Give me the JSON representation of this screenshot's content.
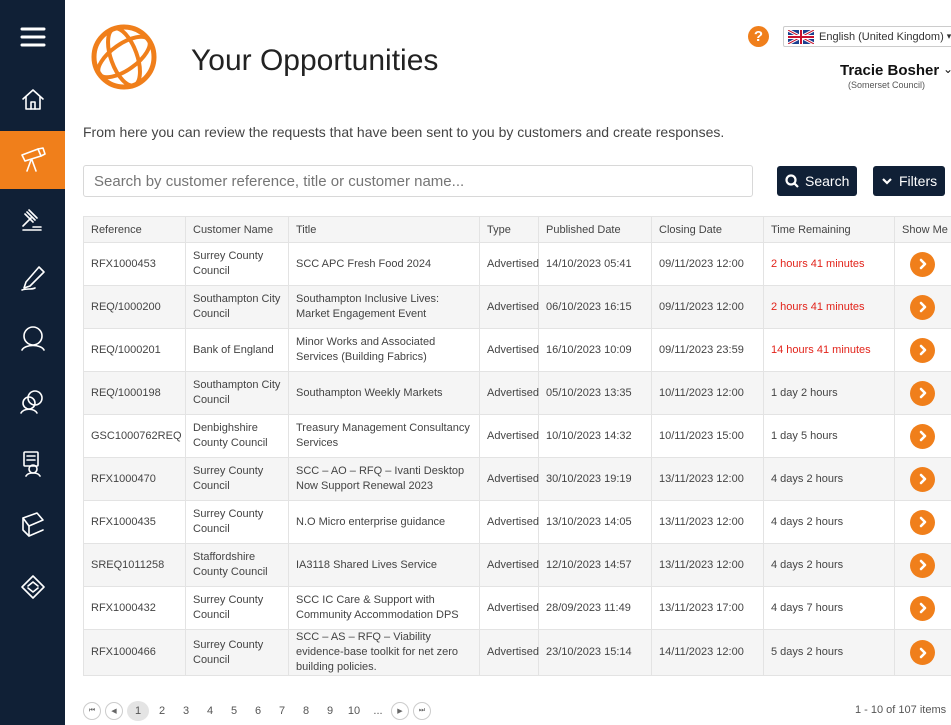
{
  "sidebar": {
    "items": [
      {
        "icon": "menu-icon",
        "active": false
      },
      {
        "icon": "home-icon",
        "active": false
      },
      {
        "icon": "telescope-icon",
        "active": true
      },
      {
        "icon": "gavel-icon",
        "active": false
      },
      {
        "icon": "pen-icon",
        "active": false
      },
      {
        "icon": "person-icon",
        "active": false
      },
      {
        "icon": "people-icon",
        "active": false
      },
      {
        "icon": "contract-user-icon",
        "active": false
      },
      {
        "icon": "book-icon",
        "active": false
      },
      {
        "icon": "handshake-icon",
        "active": false
      }
    ]
  },
  "header": {
    "title": "Your Opportunities",
    "help_label": "?",
    "language": "English (United Kingdom)",
    "user_name": "Tracie Bosher",
    "user_org": "(Somerset Council)"
  },
  "intro": "From here you can review the requests that have been sent to you by customers and create responses.",
  "search": {
    "placeholder": "Search by customer reference, title or customer name...",
    "search_label": "Search",
    "filters_label": "Filters"
  },
  "table": {
    "columns": [
      "Reference",
      "Customer Name",
      "Title",
      "Type",
      "Published Date",
      "Closing Date",
      "Time Remaining",
      "Show Me"
    ],
    "rows": [
      {
        "reference": "RFX1000453",
        "customer": "Surrey County Council",
        "title": "SCC APC Fresh Food 2024",
        "type": "Advertised",
        "published": "14/10/2023 05:41",
        "closing": "09/11/2023 12:00",
        "remaining": "2 hours 41 minutes",
        "urgent": true
      },
      {
        "reference": "REQ/1000200",
        "customer": "Southampton City Council",
        "title": "Southampton Inclusive Lives: Market Engagement Event",
        "type": "Advertised",
        "published": "06/10/2023 16:15",
        "closing": "09/11/2023 12:00",
        "remaining": "2 hours 41 minutes",
        "urgent": true
      },
      {
        "reference": "REQ/1000201",
        "customer": "Bank of England",
        "title": "Minor Works and Associated Services (Building Fabrics)",
        "type": "Advertised",
        "published": "16/10/2023 10:09",
        "closing": "09/11/2023 23:59",
        "remaining": "14 hours 41 minutes",
        "urgent": true
      },
      {
        "reference": "REQ/1000198",
        "customer": "Southampton City Council",
        "title": "Southampton Weekly Markets",
        "type": "Advertised",
        "published": "05/10/2023 13:35",
        "closing": "10/11/2023 12:00",
        "remaining": "1 day 2 hours",
        "urgent": false
      },
      {
        "reference": "GSC1000762REQ",
        "customer": "Denbighshire County Council",
        "title": "Treasury Management Consultancy Services",
        "type": "Advertised",
        "published": "10/10/2023 14:32",
        "closing": "10/11/2023 15:00",
        "remaining": "1 day 5 hours",
        "urgent": false
      },
      {
        "reference": "RFX1000470",
        "customer": "Surrey County Council",
        "title": "SCC – AO – RFQ – Ivanti Desktop Now Support Renewal 2023",
        "type": "Advertised",
        "published": "30/10/2023 19:19",
        "closing": "13/11/2023 12:00",
        "remaining": "4 days 2 hours",
        "urgent": false
      },
      {
        "reference": "RFX1000435",
        "customer": "Surrey County Council",
        "title": "N.O Micro enterprise guidance",
        "type": "Advertised",
        "published": "13/10/2023 14:05",
        "closing": "13/11/2023 12:00",
        "remaining": "4 days 2 hours",
        "urgent": false
      },
      {
        "reference": "SREQ1011258",
        "customer": "Staffordshire County Council",
        "title": "IA3118 Shared Lives Service",
        "type": "Advertised",
        "published": "12/10/2023 14:57",
        "closing": "13/11/2023 12:00",
        "remaining": "4 days 2 hours",
        "urgent": false
      },
      {
        "reference": "RFX1000432",
        "customer": "Surrey County Council",
        "title": "SCC IC Care & Support with Community Accommodation DPS",
        "type": "Advertised",
        "published": "28/09/2023 11:49",
        "closing": "13/11/2023 17:00",
        "remaining": "4 days 7 hours",
        "urgent": false
      },
      {
        "reference": "RFX1000466",
        "customer": "Surrey County Council",
        "title": "SCC – AS – RFQ – Viability evidence-base toolkit for net zero building policies.",
        "type": "Advertised",
        "published": "23/10/2023 15:14",
        "closing": "14/11/2023 12:00",
        "remaining": "5 days 2 hours",
        "urgent": false
      }
    ]
  },
  "pager": {
    "pages": [
      "1",
      "2",
      "3",
      "4",
      "5",
      "6",
      "7",
      "8",
      "9",
      "10",
      "..."
    ],
    "current": "1",
    "info": "1 - 10 of 107 items"
  },
  "colors": {
    "sidebar": "#102036",
    "accent": "#f07f1b",
    "urgent": "#e2231a"
  }
}
